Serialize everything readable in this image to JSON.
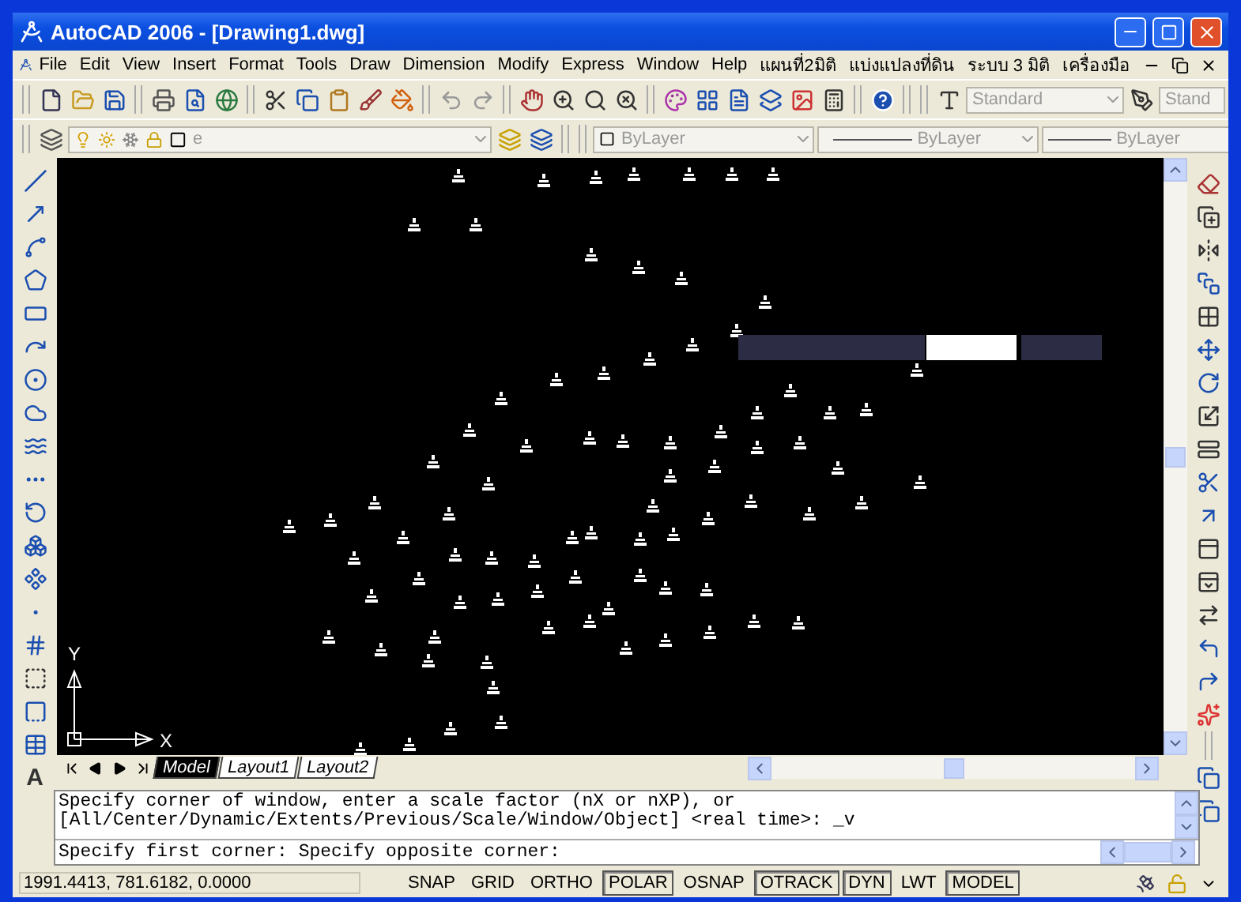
{
  "window": {
    "title": "AutoCAD 2006 - [Drawing1.dwg]"
  },
  "menu": [
    "File",
    "Edit",
    "View",
    "Insert",
    "Format",
    "Tools",
    "Draw",
    "Dimension",
    "Modify",
    "Express",
    "Window",
    "Help",
    "แผนที่2มิติ",
    "แบ่งแปลงที่ดิน",
    "ระบบ 3 มิติ",
    "เครื่องมือ"
  ],
  "styles_toolbar": {
    "text_style": "Standard",
    "dim_style": "Stand"
  },
  "layers_toolbar": {
    "layer": "e"
  },
  "properties_toolbar": {
    "color_control": "ByLayer",
    "linetype": "ByLayer",
    "lineweight": "ByLayer"
  },
  "drawing": {
    "ucs": {
      "x_label": "X",
      "y_label": "Y"
    }
  },
  "left_toolbar": {
    "text_glyph": "A"
  },
  "layout_tabs": [
    {
      "label": "Model",
      "selected": true
    },
    {
      "label": "Layout1",
      "selected": false
    },
    {
      "label": "Layout2",
      "selected": false
    }
  ],
  "command_history": [
    "Specify corner of window, enter a scale factor (nX or nXP), or",
    "[All/Center/Dynamic/Extents/Previous/Scale/Window/Object] <real time>: _v"
  ],
  "command_line": "Specify first corner: Specify opposite corner:",
  "status_bar": {
    "coordinates": "1991.4413, 781.6182, 0.0000",
    "toggles": [
      {
        "label": "SNAP",
        "on": false
      },
      {
        "label": "GRID",
        "on": false
      },
      {
        "label": "ORTHO",
        "on": false
      },
      {
        "label": "POLAR",
        "on": true
      },
      {
        "label": "OSNAP",
        "on": false
      },
      {
        "label": "OTRACK",
        "on": true
      },
      {
        "label": "DYN",
        "on": true
      },
      {
        "label": "LWT",
        "on": false
      },
      {
        "label": "MODEL",
        "on": true
      }
    ]
  }
}
